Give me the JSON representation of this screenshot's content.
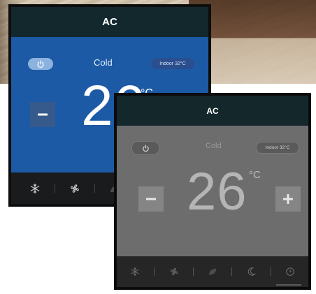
{
  "panel_blue": {
    "title": "AC",
    "mode": "Cold",
    "indoor_label": "Indoor 32°C",
    "temperature": "26",
    "unit": "°C",
    "minus_label": "−",
    "bottom_icons": [
      "snowflake-icon",
      "fan-icon",
      "leaf-icon"
    ]
  },
  "panel_grey": {
    "title": "AC",
    "mode": "Cold",
    "indoor_label": "Indoor 32°C",
    "temperature": "26",
    "unit": "°C",
    "minus_label": "−",
    "plus_label": "+",
    "bottom_icons": [
      "snowflake-icon",
      "fan-icon",
      "leaf-icon",
      "moon-icon",
      "clock-icon"
    ]
  },
  "colors": {
    "blue_screen": "#1d5aa6",
    "grey_screen": "#6d6d6d",
    "topbar": "#13282c",
    "bottombar": "#1a1b1d"
  }
}
